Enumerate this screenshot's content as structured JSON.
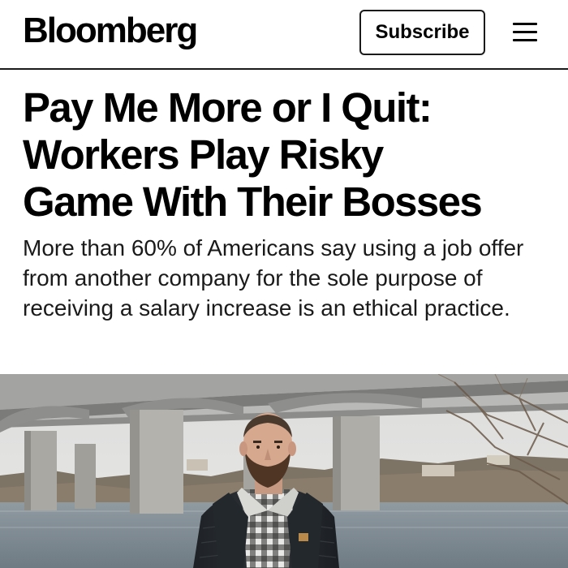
{
  "header": {
    "logo_text": "Bloomberg",
    "subscribe_label": "Subscribe",
    "menu_icon": "hamburger-menu-icon"
  },
  "article": {
    "headline_lines": [
      "Pay Me More or I Quit:",
      "Workers Play Risky",
      "Game With Their Bosses"
    ],
    "dek": "More than 60% of Americans say using a job offer from another company for the sole purpose of receiving a salary increase is an ethical practice.",
    "photo": "Man in plaid shirt and dark jacket standing by a river beneath a concrete highway bridge"
  },
  "colors": {
    "text": "#000000",
    "header_rule": "#1a1a1a",
    "background": "#ffffff"
  }
}
